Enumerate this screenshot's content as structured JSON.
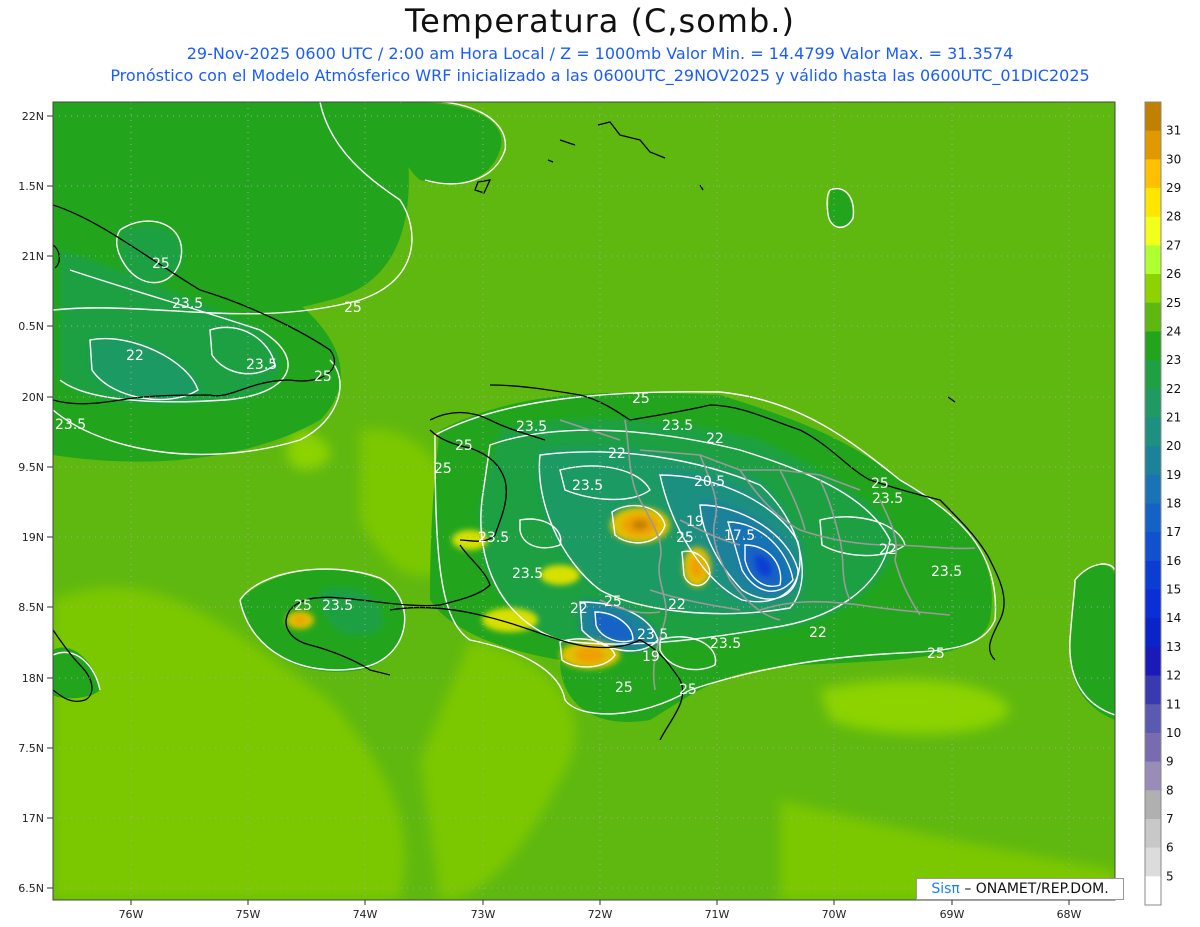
{
  "header": {
    "title": "Temperatura (C,somb.)",
    "line1": "29-Nov-2025  0600 UTC / 2:00 am Hora Local / Z = 1000mb    Valor Min. = 14.4799  Valor Max. = 31.3574",
    "line2": "Pronóstico con el Modelo Atmósferico WRF inicializado a las 0600UTC_29NOV2025 y válido hasta las  0600UTC_01DIC2025"
  },
  "map": {
    "lat_labels": [
      "22N",
      "1.5N",
      "21N",
      "0.5N",
      "20N",
      "9.5N",
      "19N",
      "8.5N",
      "18N",
      "7.5N",
      "17N",
      "6.5N"
    ],
    "lon_labels": [
      "76W",
      "75W",
      "74W",
      "73W",
      "72W",
      "71W",
      "70W",
      "69W",
      "68W"
    ],
    "contour_labels": [
      {
        "text": "25"
      },
      {
        "text": "23.5"
      },
      {
        "text": "22"
      },
      {
        "text": "23.5"
      },
      {
        "text": "25"
      },
      {
        "text": "23.5"
      },
      {
        "text": "25"
      },
      {
        "text": "23.5"
      },
      {
        "text": "22"
      },
      {
        "text": "25"
      },
      {
        "text": "25"
      },
      {
        "text": "23.5"
      },
      {
        "text": "22"
      },
      {
        "text": "20.5"
      },
      {
        "text": "23.5"
      },
      {
        "text": "25"
      },
      {
        "text": "23.5"
      },
      {
        "text": "19"
      },
      {
        "text": "25"
      },
      {
        "text": "17.5"
      },
      {
        "text": "22"
      },
      {
        "text": "23.5"
      },
      {
        "text": "23.5"
      },
      {
        "text": "25"
      },
      {
        "text": "23.5"
      },
      {
        "text": "25"
      },
      {
        "text": "22"
      },
      {
        "text": "25"
      },
      {
        "text": "23.5"
      },
      {
        "text": "22"
      },
      {
        "text": "23.5"
      },
      {
        "text": "19"
      },
      {
        "text": "23.5"
      },
      {
        "text": "22"
      },
      {
        "text": "25"
      },
      {
        "text": "25"
      },
      {
        "text": "25"
      }
    ],
    "colors": {
      "c24": "#22a51d",
      "c25": "#5fb80f",
      "c26": "#8cd300",
      "c23": "#1fa043",
      "c22": "#1f9a63",
      "c21": "#1e9080",
      "c20": "#1b8299",
      "c19": "#1973b5",
      "c18": "#1562c6",
      "c17": "#1150cf",
      "c16": "#0b3cd3",
      "c29": "#ffc800",
      "c30": "#f0a000",
      "c31": "#c08000"
    }
  },
  "colorbar": {
    "labels": [
      "31",
      "30",
      "29",
      "28",
      "27",
      "26",
      "25",
      "24",
      "23",
      "22",
      "21",
      "20",
      "19",
      "18",
      "17",
      "16",
      "15",
      "14",
      "13",
      "12",
      "11",
      "10",
      "9",
      "8",
      "7",
      "6",
      "5"
    ],
    "colors": [
      "#c08000",
      "#e09a00",
      "#ffc000",
      "#ffe600",
      "#f2ff1a",
      "#b0ff30",
      "#8cd300",
      "#5fb80f",
      "#22a51d",
      "#1fa043",
      "#1f9a63",
      "#1e9080",
      "#1b8299",
      "#1973b5",
      "#1562c6",
      "#1150cf",
      "#0b3cd3",
      "#0a2fd6",
      "#0a24c8",
      "#1a1ab8",
      "#3a3ab0",
      "#5a5ab0",
      "#7a6bb0",
      "#9a8cb8",
      "#b0b0b0",
      "#c8c8c8",
      "#dcdcdc",
      "#ffffff"
    ]
  },
  "credit": {
    "brand": "Sisπ",
    "text": "– ONAMET/REP.DOM."
  }
}
